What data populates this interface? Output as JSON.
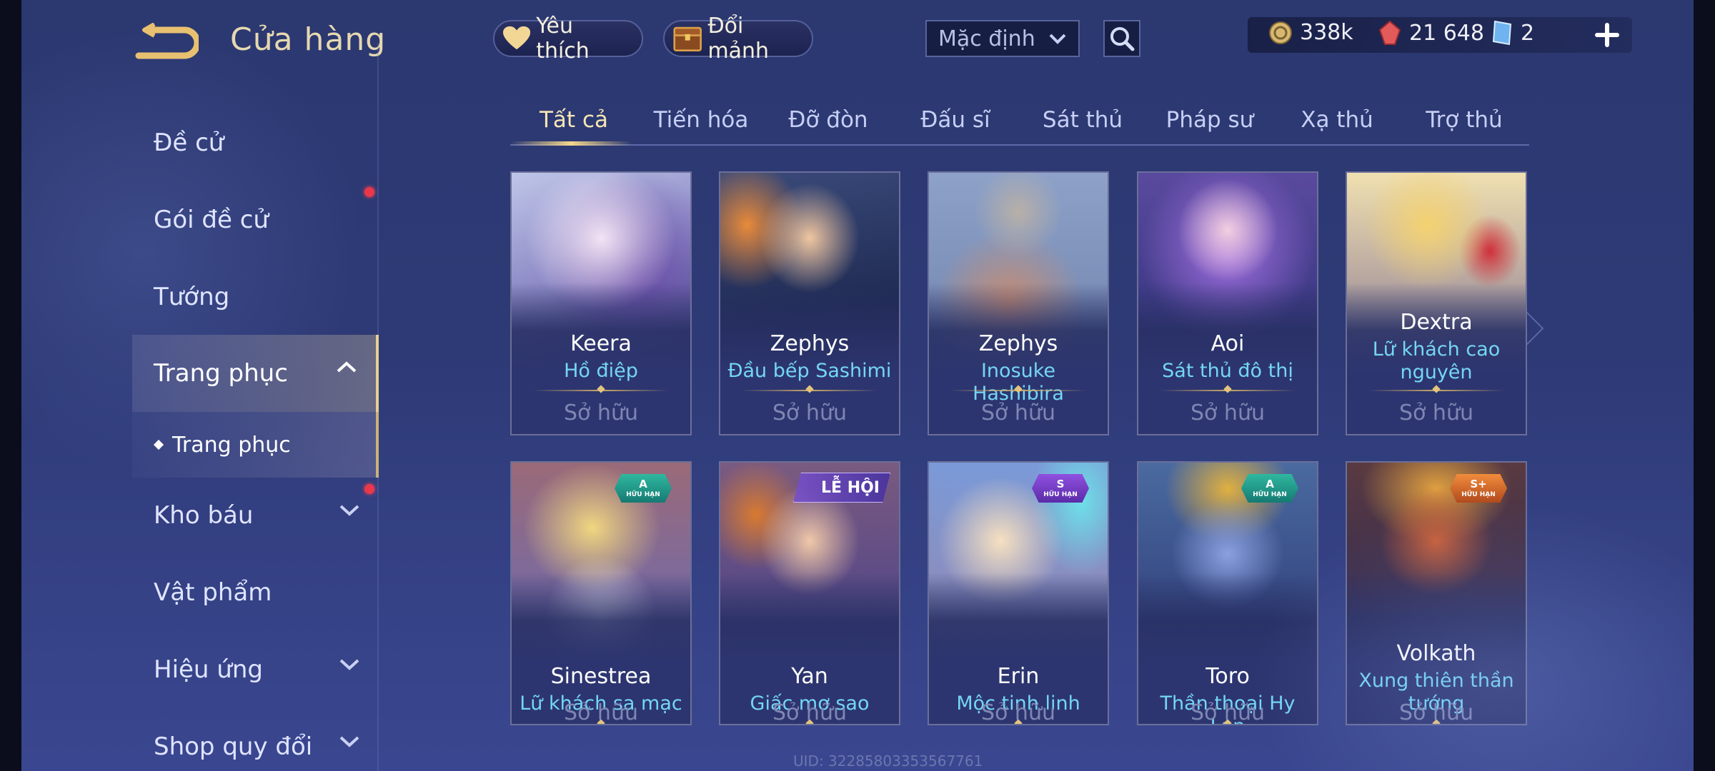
{
  "header": {
    "title": "Cửa hàng",
    "back_icon": "back-arrow-icon",
    "favorites_label": "Yêu thích",
    "fragments_label": "Đổi mảnh",
    "sort_value": "Mặc định",
    "currencies": {
      "gold": "338k",
      "vouchers": "21 648",
      "tickets": "2"
    }
  },
  "sidebar": {
    "items": [
      {
        "label": "Đề cử"
      },
      {
        "label": "Gói đề cử"
      },
      {
        "label": "Tướng"
      },
      {
        "label": "Trang phục"
      },
      {
        "label": "Kho báu"
      },
      {
        "label": "Vật phẩm"
      },
      {
        "label": "Hiệu ứng"
      },
      {
        "label": "Shop quy đổi"
      }
    ],
    "sub_item": "Trang phục"
  },
  "tabs": [
    "Tất cả",
    "Tiến hóa",
    "Đỡ đòn",
    "Đấu sĩ",
    "Sát thủ",
    "Pháp sư",
    "Xạ thủ",
    "Trợ thủ"
  ],
  "active_tab": "Tất cả",
  "cards": [
    {
      "hero": "Keera",
      "skin": "Hồ điệp",
      "status": "Sở hữu"
    },
    {
      "hero": "Zephys",
      "skin": "Đầu bếp Sashimi",
      "status": "Sở hữu"
    },
    {
      "hero": "Zephys",
      "skin": "Inosuke Hashibira",
      "status": "Sở hữu"
    },
    {
      "hero": "Aoi",
      "skin": "Sát thủ đô thị",
      "status": "Sở hữu"
    },
    {
      "hero": "Dextra",
      "skin": "Lữ khách cao nguyên",
      "status": "Sở hữu"
    },
    {
      "hero": "Sinestrea",
      "skin": "Lữ khách sa mạc",
      "status": "Sở hữu",
      "badge": "A",
      "badge_sub": "HỮU HẠN"
    },
    {
      "hero": "Yan",
      "skin": "Giấc mơ sao",
      "status": "Sở hữu",
      "event": "LỄ HỘI"
    },
    {
      "hero": "Erin",
      "skin": "Mộc tinh linh",
      "status": "Sở hữu",
      "badge": "S",
      "badge_sub": "HỮU HẠN"
    },
    {
      "hero": "Toro",
      "skin": "Thần thoại Hy Lạp",
      "status": "Sở hữu",
      "badge": "A",
      "badge_sub": "HỮU HẠN"
    },
    {
      "hero": "Volkath",
      "skin": "Xung thiên thần tướng",
      "status": "Sở hữu",
      "badge": "S+",
      "badge_sub": "HỮU HẠN"
    }
  ],
  "uid_text": "UID: 32285803353567761",
  "colors": {
    "accent_gold": "#e6cf8e",
    "skin_name": "#74d7f2",
    "badge_a": "#1f9a88",
    "badge_s": "#7a3fcc",
    "badge_s_plus": "#d06a2c",
    "notification": "#e8384a"
  }
}
